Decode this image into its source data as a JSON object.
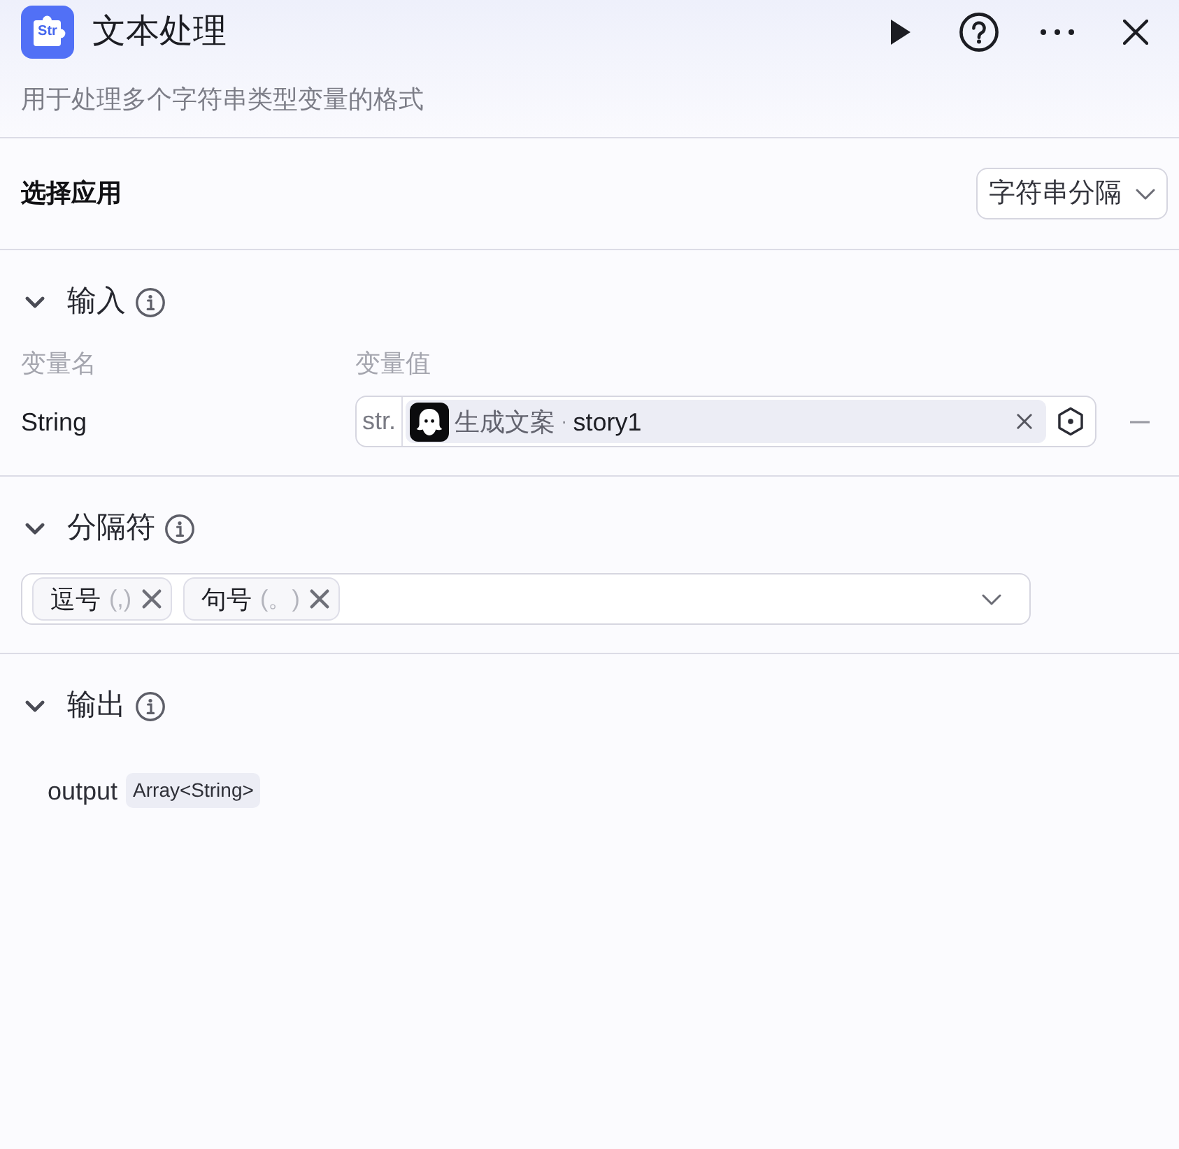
{
  "header": {
    "logo_text": "Str",
    "title": "文本处理",
    "description": "用于处理多个字符串类型变量的格式"
  },
  "app_select": {
    "label": "选择应用",
    "value": "字符串分隔"
  },
  "sections": [
    {
      "kind": "input",
      "title": "输入",
      "expanded": true,
      "columns": [
        "变量名",
        "变量值"
      ],
      "rows": [
        {
          "name": "String",
          "type_prefix": "str.",
          "source_node": "生成文案",
          "separator": "·",
          "variable": "story1"
        }
      ]
    },
    {
      "kind": "separator",
      "title": "分隔符",
      "expanded": true,
      "selected_options": [
        {
          "label": "逗号",
          "symbol": "(,)"
        },
        {
          "label": "句号",
          "symbol": "(。)"
        }
      ]
    },
    {
      "kind": "output",
      "title": "输出",
      "expanded": true,
      "outputs": [
        {
          "name": "output",
          "type": "Array<String>"
        }
      ]
    }
  ]
}
